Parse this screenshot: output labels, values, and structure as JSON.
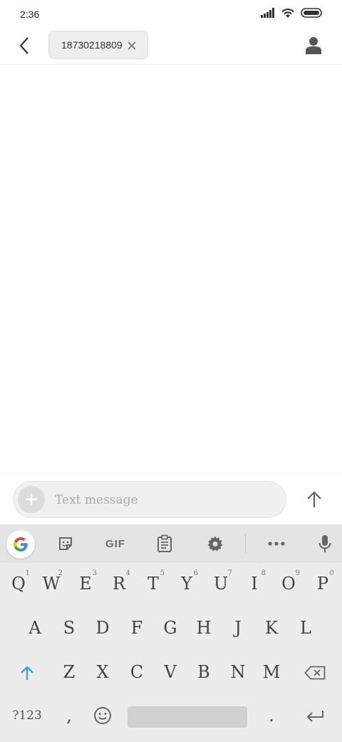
{
  "status_bar": {
    "time": "2:36"
  },
  "header": {
    "recipient": "18730218809"
  },
  "compose": {
    "placeholder": "Text message"
  },
  "keyboard": {
    "toolbar": {
      "gif_label": "GIF"
    },
    "row1": [
      {
        "label": "Q",
        "hint": "1"
      },
      {
        "label": "W",
        "hint": "2"
      },
      {
        "label": "E",
        "hint": "3"
      },
      {
        "label": "R",
        "hint": "4"
      },
      {
        "label": "T",
        "hint": "5"
      },
      {
        "label": "Y",
        "hint": "6"
      },
      {
        "label": "U",
        "hint": "7"
      },
      {
        "label": "I",
        "hint": "8"
      },
      {
        "label": "O",
        "hint": "9"
      },
      {
        "label": "P",
        "hint": "0"
      }
    ],
    "row2": [
      "A",
      "S",
      "D",
      "F",
      "G",
      "H",
      "J",
      "K",
      "L"
    ],
    "row3": [
      "Z",
      "X",
      "C",
      "V",
      "B",
      "N",
      "M"
    ],
    "row4": {
      "symbols_label": "?123",
      "comma": ",",
      "period": "."
    }
  },
  "colors": {
    "accent_blue": "#2a9df4",
    "keyboard_bg": "#ececec",
    "toolbar_bg": "#e4e4e4"
  }
}
